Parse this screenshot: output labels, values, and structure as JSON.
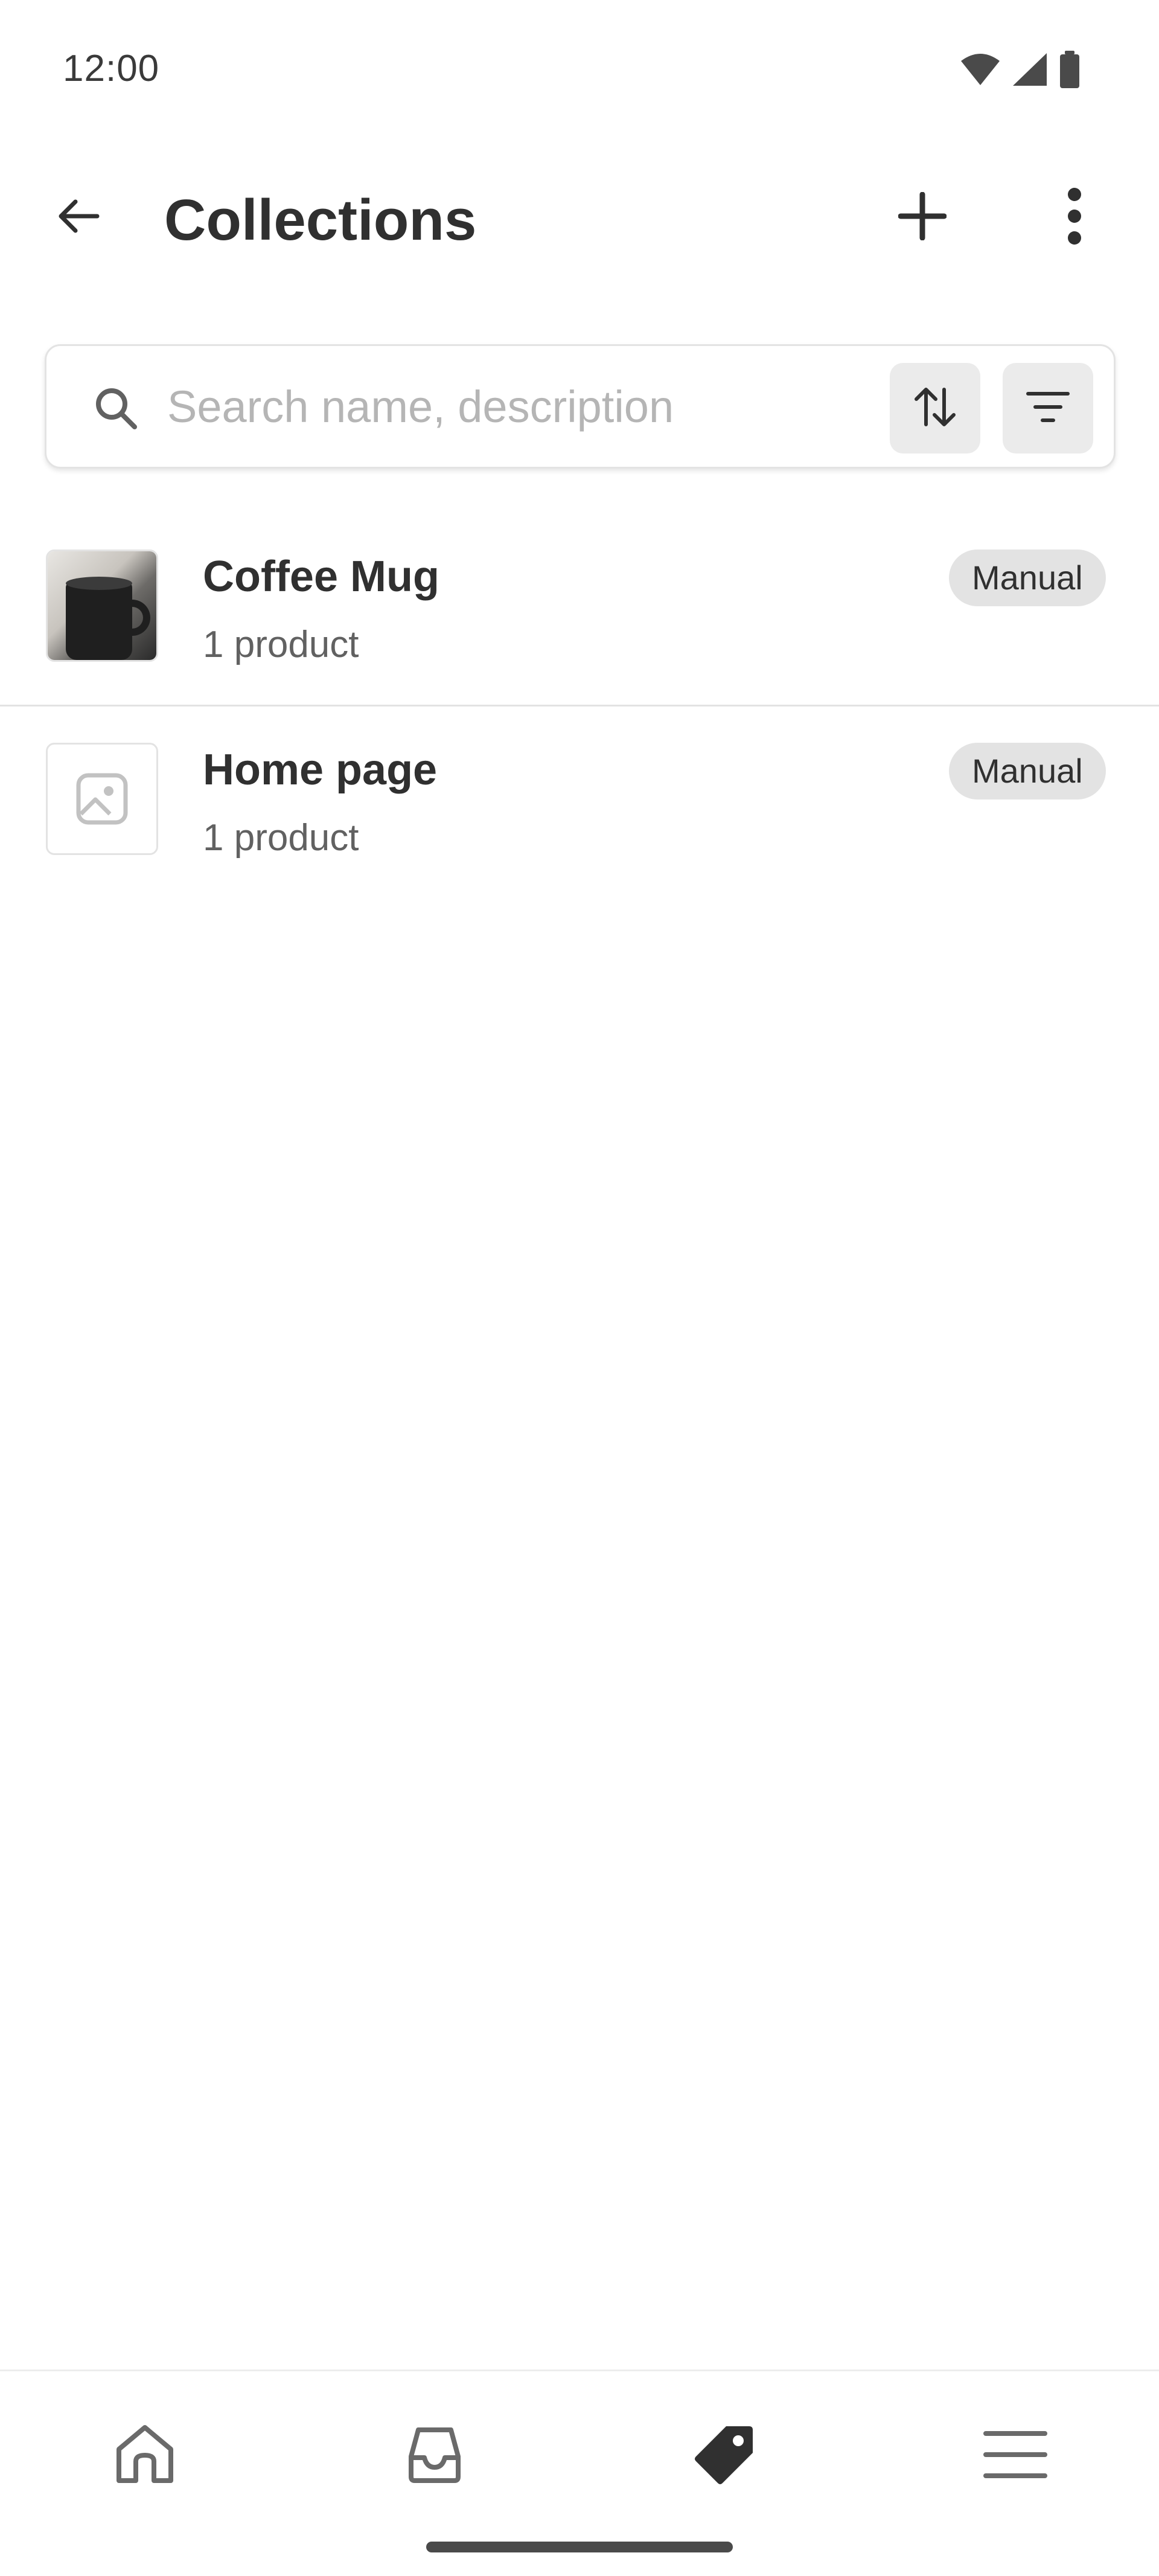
{
  "status_bar": {
    "time": "12:00",
    "icons": [
      "wifi-icon",
      "cellular-signal-icon",
      "battery-icon"
    ]
  },
  "app_bar": {
    "title": "Collections",
    "back_icon": "arrow-left-icon",
    "add_icon": "plus-icon",
    "more_icon": "more-vertical-icon"
  },
  "search": {
    "placeholder": "Search name, description",
    "value": "",
    "sort_icon": "sort-arrows-icon",
    "filter_icon": "filter-lines-icon"
  },
  "collections": [
    {
      "title": "Coffee Mug",
      "subtitle": "1 product",
      "badge": "Manual",
      "thumbnail": "coffee-mug-photo"
    },
    {
      "title": "Home page",
      "subtitle": "1 product",
      "badge": "Manual",
      "thumbnail": "image-placeholder-icon"
    }
  ],
  "bottom_nav": {
    "items": [
      {
        "icon": "home-icon",
        "active": false
      },
      {
        "icon": "orders-inbox-icon",
        "active": false
      },
      {
        "icon": "products-tag-icon",
        "active": true
      },
      {
        "icon": "menu-icon",
        "active": false
      }
    ]
  },
  "colors": {
    "text_primary": "#303030",
    "text_secondary": "#616161",
    "placeholder": "#b5b5b5",
    "badge_bg": "#e3e3e3",
    "icon_button_bg": "#ebebeb",
    "divider": "#e3e3e3"
  }
}
